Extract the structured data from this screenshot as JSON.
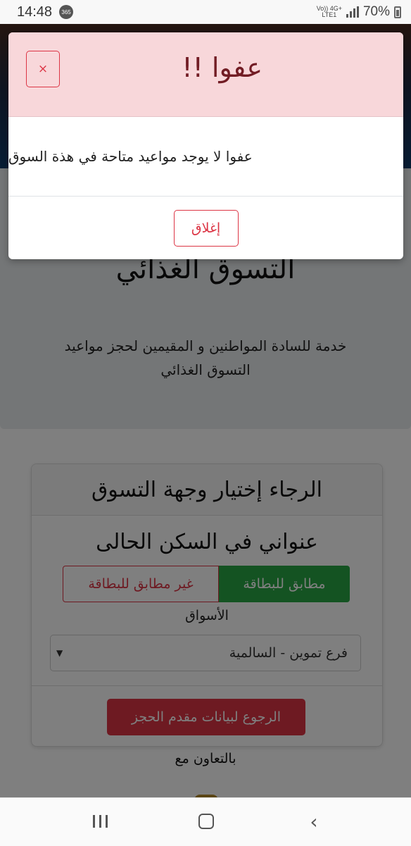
{
  "status_bar": {
    "time": "14:48",
    "app_badge": "365",
    "network_top": "Vo)) 4G+",
    "network_bottom": "LTE1",
    "battery": "70%"
  },
  "page": {
    "hero_title": "التسوق الغذائي",
    "hero_description": "خدمة للسادة المواطنين و المقيمين لحجز مواعيد التسوق الغذائي",
    "form": {
      "header": "الرجاء إختيار وجهة التسوق",
      "address_title": "عنواني في السكن الحالى",
      "match_option": "مطابق للبطاقة",
      "nomatch_option": "غير مطابق للبطاقة",
      "markets_label": "الأسواق",
      "market_selected": "فرع تموين - السالمية",
      "back_button": "الرجوع لبيانات مقدم الحجز"
    },
    "cooperation": "بالتعاون مع"
  },
  "modal": {
    "title": "عفوا !!",
    "close_symbol": "×",
    "message": "عفوا لا يوجد مواعيد متاحة في هذة السوق",
    "close_button": "إغلاق",
    "colors": {
      "header_bg": "#f8d7da",
      "title": "#721c24",
      "accent": "#dc3545"
    }
  },
  "colors": {
    "success": "#28a745",
    "danger": "#dc3545"
  },
  "nav_bar": {
    "icons": [
      "recent-apps-icon",
      "home-icon",
      "back-icon"
    ]
  }
}
